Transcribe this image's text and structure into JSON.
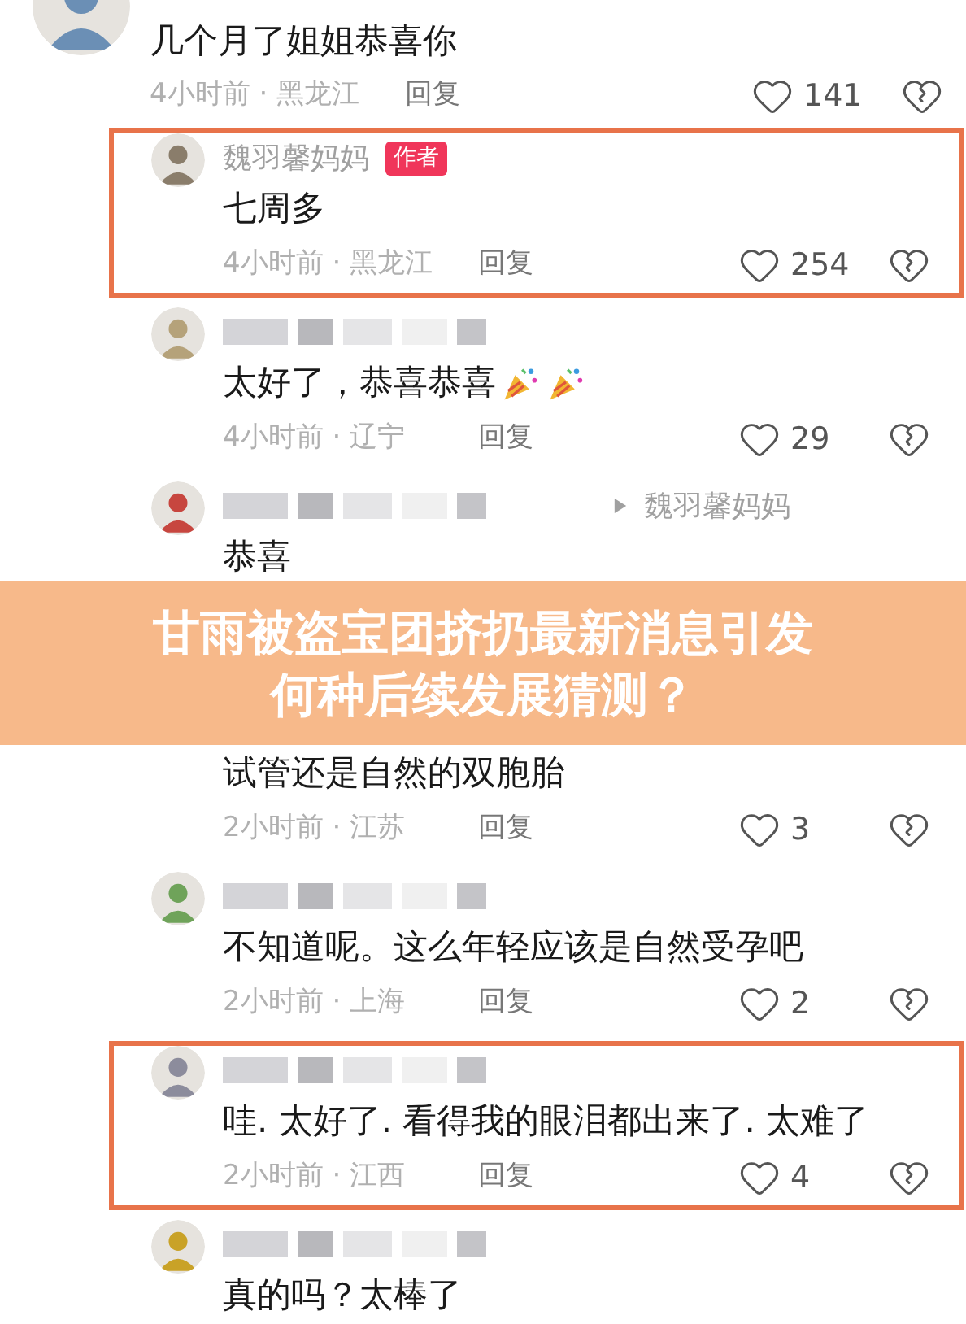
{
  "comments": [
    {
      "kind": "top",
      "text": "几个月了姐姐恭喜你",
      "meta": "4小时前 · 黑龙江",
      "reply_label": "回复",
      "likes": "141"
    },
    {
      "kind": "reply",
      "name": "魏羽馨妈妈",
      "badge": "作者",
      "text": "七周多",
      "meta": "4小时前 · 黑龙江",
      "reply_label": "回复",
      "likes": "254",
      "highlighted": true
    },
    {
      "kind": "reply",
      "name_hidden": true,
      "text": "太好了，恭喜恭喜",
      "party": true,
      "meta": "4小时前 · 辽宁",
      "reply_label": "回复",
      "likes": "29",
      "highlighted": false
    },
    {
      "kind": "reply",
      "name_hidden": true,
      "reply_to": "魏羽馨妈妈",
      "text": "恭喜",
      "highlighted": false
    },
    {
      "kind": "reply",
      "covered_header": true,
      "text": "试管还是自然的双胞胎",
      "meta": "2小时前 · 江苏",
      "reply_label": "回复",
      "likes": "3",
      "highlighted": false
    },
    {
      "kind": "reply",
      "name_hidden": true,
      "text": "不知道呢。这么年轻应该是自然受孕吧",
      "meta": "2小时前 · 上海",
      "reply_label": "回复",
      "likes": "2",
      "highlighted": false
    },
    {
      "kind": "reply",
      "name_hidden": true,
      "text": "哇. 太好了. 看得我的眼泪都出来了. 太难了",
      "meta": "2小时前 · 江西",
      "reply_label": "回复",
      "likes": "4",
      "highlighted": true
    },
    {
      "kind": "reply",
      "name_hidden": true,
      "text": "真的吗？太棒了",
      "highlighted": false
    }
  ],
  "banner": {
    "lines": [
      "甘雨被盗宝团挤扔最新消息引发",
      "何种后续发展猜测？"
    ]
  }
}
